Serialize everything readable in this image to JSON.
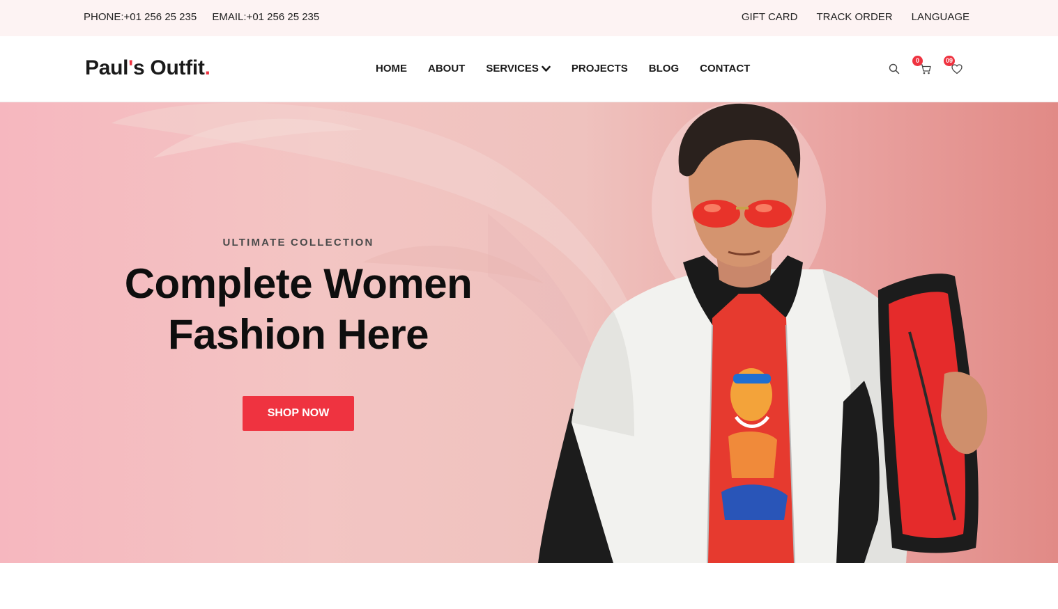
{
  "topbar": {
    "phone": "PHONE:+01 256 25 235",
    "email": "EMAIL:+01 256 25 235",
    "links": [
      "GIFT CARD",
      "TRACK ORDER",
      "LANGUAGE"
    ]
  },
  "header": {
    "logo_main": "Paul",
    "logo_apostrophe": "'",
    "logo_rest": "s Outfit",
    "logo_dot": ".",
    "nav": [
      {
        "label": "HOME"
      },
      {
        "label": "ABOUT"
      },
      {
        "label": "SERVICES"
      },
      {
        "label": "PROJECTS"
      },
      {
        "label": "BLOG"
      },
      {
        "label": "CONTACT"
      }
    ],
    "icons": {
      "search": "search-icon",
      "cart": "cart-icon",
      "wishlist": "heart-icon"
    },
    "cart_count": "0",
    "wishlist_count": "09"
  },
  "hero": {
    "eyebrow": "ULTIMATE COLLECTION",
    "title_line1": "Complete Women",
    "title_line2": "Fashion Here",
    "button_label": "SHOP NOW"
  },
  "colors": {
    "accent": "#ef3340",
    "topbar_bg": "#fdf3f3",
    "hero_left": "#f6b7bf",
    "hero_right": "#e18a86"
  }
}
